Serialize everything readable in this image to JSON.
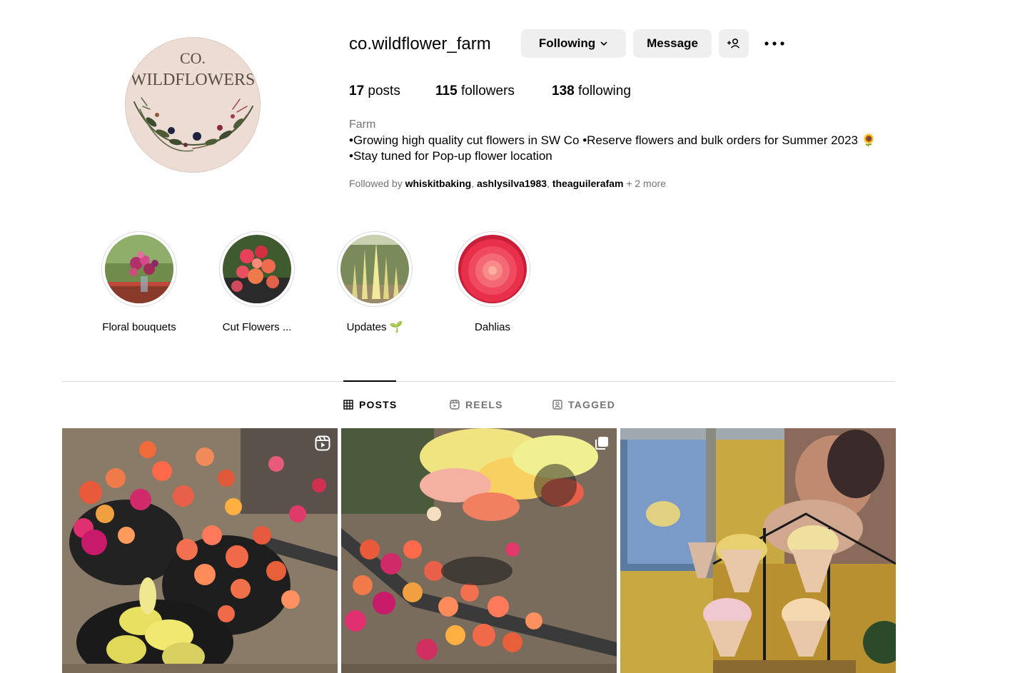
{
  "profile": {
    "username": "co.wildflower_farm",
    "avatar_text": {
      "line1": "CO.",
      "line2": "WILDFLOWERS"
    },
    "buttons": {
      "following": "Following",
      "message": "Message"
    },
    "stats": {
      "posts_count": "17",
      "posts_label": "posts",
      "followers_count": "115",
      "followers_label": "followers",
      "following_count": "138",
      "following_label": "following"
    },
    "category": "Farm",
    "bio": [
      "•Growing high quality cut flowers in SW Co •Reserve flowers and bulk orders for Summer 2023 🌻",
      "•Stay tuned for Pop-up flower location"
    ],
    "followed_by": {
      "prefix": "Followed by",
      "users": [
        "whiskitbaking",
        "ashlysilva1983",
        "theaguilerafam"
      ],
      "suffix": "+ 2 more"
    }
  },
  "highlights": [
    {
      "label": "Floral bouquets"
    },
    {
      "label": "Cut Flowers ..."
    },
    {
      "label": "Updates 🌱"
    },
    {
      "label": "Dahlias"
    }
  ],
  "tabs": [
    {
      "label": "POSTS",
      "icon": "grid-icon",
      "active": true
    },
    {
      "label": "REELS",
      "icon": "reels-icon",
      "active": false
    },
    {
      "label": "TAGGED",
      "icon": "tagged-icon",
      "active": false
    }
  ],
  "posts": [
    {
      "badge": "reel-icon"
    },
    {
      "badge": "carousel-icon"
    },
    {
      "badge": ""
    }
  ],
  "colors": {
    "button_bg": "#efefef",
    "secondary_text": "#737373",
    "divider": "#dbdbdb",
    "avatar_bg": "#ecdcd3",
    "avatar_text": "#5a4f45"
  }
}
